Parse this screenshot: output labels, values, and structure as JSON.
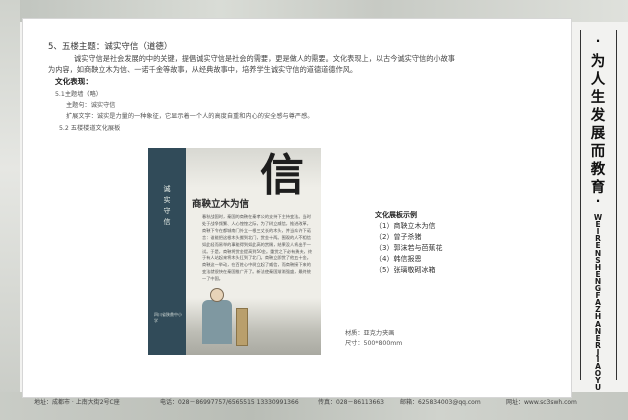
{
  "section": {
    "heading": "5、五楼主题：诚实守信（道德）",
    "intro_lines": [
      "诚实守信是社会发展的中的关键，提倡诚实守信是社会的需要，更是做人的需要。文化表现上，以古今诚实守信的小故事",
      "为内容，如商鞅立木为信、一诺千金等故事，从经典故事中，培养学生诚实守信的道德道德作风。"
    ],
    "culture_label": "文化表现：",
    "wall_item": "5.1主题墙（略）",
    "wall_theme": "主题句：诚实守信",
    "wall_ext": "扩展文字：诚实是力量的一种象征，它显示着一个人的高度自重和内心的安全感与尊严感。",
    "board_item": "5.2 五楼楼道文化展板"
  },
  "board": {
    "band_title": "诚实守信",
    "big_char": "信",
    "story_title": "商鞅立木为信",
    "story_text": "春秋战国时，秦国的商鞅在秦孝公的支持下主持变法。当时处于战争频繁、人心惶惶之际，为了树立威信，推进改革，商鞅下令在都城南门外立一根三丈长的木头，并当众许下诺言：谁能把这根木头搬到北门，赏金十两。围观的人不相信如此轻而易举的事能得到如此高的赏赐，结果没人肯出手一试。于是，商鞅将赏金提高到50金。重赏之下必有勇夫，终于有人站起来将木头扛到了北门。商鞅立即赏了他五十金。商鞅这一举动，在百姓心中树立起了威信，而商鞅接下来的变法就很快在秦国推广开了。新法使秦国渐渐强盛，最终统一了中国。",
    "org": "四川省陕鼎中小学"
  },
  "specs": {
    "material": "材质：亚克力夹画",
    "size": "尺寸：500*800mm"
  },
  "examples": {
    "title": "文化展板示例",
    "items": [
      "（1）商鞅立木为信",
      "（2）曾子杀猪",
      "（3）郭沫若与芭蕉花",
      "（4）韩信报恩",
      "（5）张璃敬砌冰箱"
    ]
  },
  "side_banner": {
    "chinese_chars": [
      "为",
      "人",
      "生",
      "发",
      "展",
      "而",
      "教",
      "育"
    ],
    "dot": "·",
    "pinyin": "WEIRENSHENGFAZHANERJIAOYU"
  },
  "footer": {
    "address": "地址：成都市 · 上南大街2号C座",
    "phone": "电话：028－86997757/6565515  13330991366",
    "fax": "传真：028－86113663",
    "email": "邮箱：625834003@qq.com",
    "website": "网址：www.sc3swh.com"
  }
}
